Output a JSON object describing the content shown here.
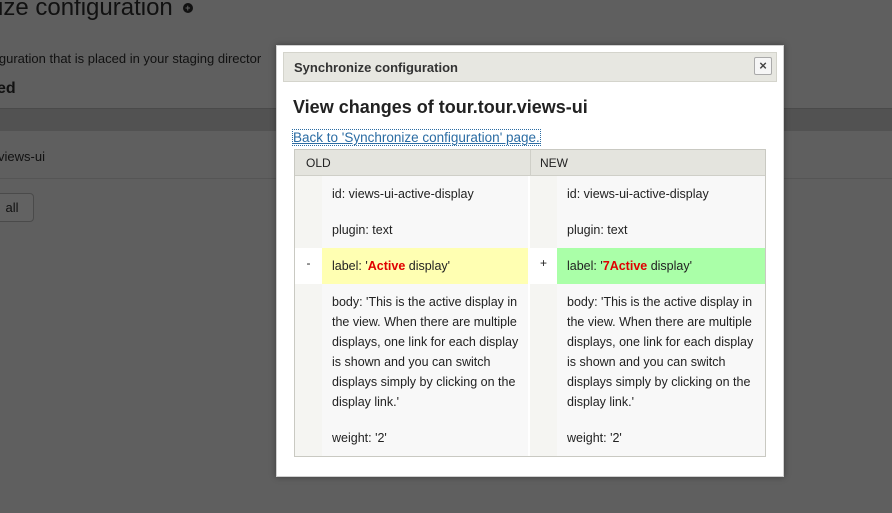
{
  "background": {
    "title": "ize configuration",
    "add_icon": "plus",
    "description": "iguration that is placed in your staging director",
    "heading": "ed",
    "row_text": "views-ui",
    "button_label": "all"
  },
  "dialog": {
    "title": "Synchronize configuration",
    "close_label": "×",
    "heading": "View changes of tour.tour.views-ui",
    "back_link": "Back to 'Synchronize configuration' page.",
    "columns": {
      "old": "OLD",
      "new": "NEW"
    },
    "rows": {
      "id": {
        "old": "id: views-ui-active-display",
        "new": "id: views-ui-active-display"
      },
      "plugin": {
        "old": "plugin: text",
        "new": "plugin: text"
      },
      "label": {
        "old_marker": "-",
        "new_marker": "+",
        "old_prefix": "label: '",
        "old_highlight": "Active",
        "old_suffix": " display'",
        "new_prefix": "label: '",
        "new_highlight": "7Active",
        "new_suffix": " display'"
      },
      "body": {
        "old": "body: 'This is the active display in the view. When there are multiple displays, one link for each display is shown and you can switch displays simply by clicking on the display link.'",
        "new": "body: 'This is the active display in the view. When there are multiple displays, one link for each display is shown and you can switch displays simply by clicking on the display link.'"
      },
      "weight": {
        "old": "weight: '2'",
        "new": "weight: '2'"
      }
    }
  },
  "colors": {
    "removed_bg": "#ffffb2",
    "added_bg": "#aaffa8",
    "highlight": "#e00000",
    "link": "#2b6ca3"
  }
}
